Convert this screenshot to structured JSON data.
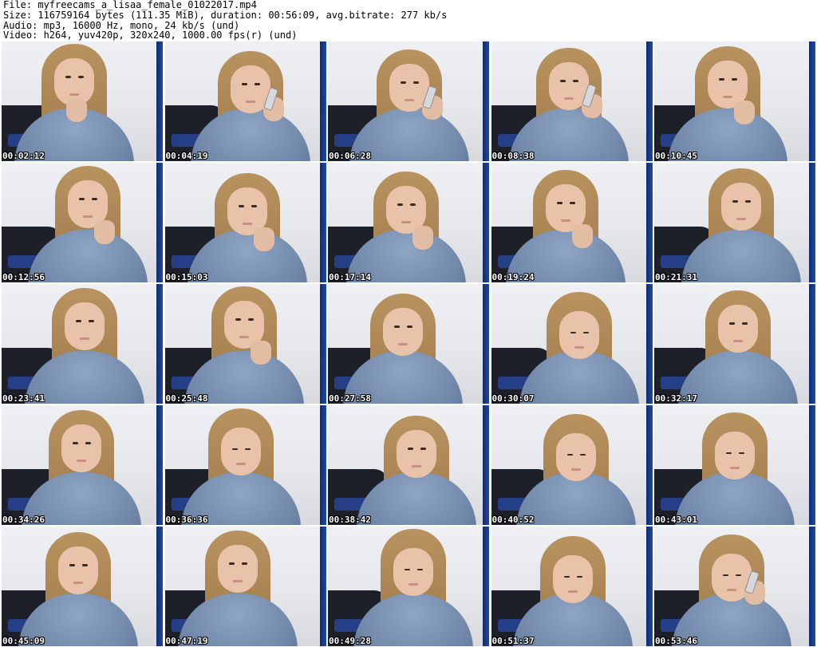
{
  "header": {
    "file_line": "File: myfreecams_a_lisaa_female_01022017.mp4",
    "size_line": "Size: 116759164 bytes (111.35 MiB), duration: 00:56:09, avg.bitrate: 277 kb/s",
    "audio_line": "Audio: mp3, 16000 Hz, mono, 24 kb/s (und)",
    "video_line": "Video: h264, yuv420p, 320x240, 1000.00 fps(r) (und)"
  },
  "thumbnails": [
    {
      "timestamp": "00:02:12",
      "pose": "chin"
    },
    {
      "timestamp": "00:04:19",
      "pose": "phone"
    },
    {
      "timestamp": "00:06:28",
      "pose": "phone"
    },
    {
      "timestamp": "00:08:38",
      "pose": "phone"
    },
    {
      "timestamp": "00:10:45",
      "pose": "hand"
    },
    {
      "timestamp": "00:12:56",
      "pose": "hand"
    },
    {
      "timestamp": "00:15:03",
      "pose": "hand"
    },
    {
      "timestamp": "00:17:14",
      "pose": "hand"
    },
    {
      "timestamp": "00:19:24",
      "pose": "hand"
    },
    {
      "timestamp": "00:21:31",
      "pose": "none"
    },
    {
      "timestamp": "00:23:41",
      "pose": "none"
    },
    {
      "timestamp": "00:25:48",
      "pose": "hand"
    },
    {
      "timestamp": "00:27:58",
      "pose": "none"
    },
    {
      "timestamp": "00:30:07",
      "pose": "down"
    },
    {
      "timestamp": "00:32:17",
      "pose": "none"
    },
    {
      "timestamp": "00:34:26",
      "pose": "none"
    },
    {
      "timestamp": "00:36:36",
      "pose": "down"
    },
    {
      "timestamp": "00:38:42",
      "pose": "none"
    },
    {
      "timestamp": "00:40:52",
      "pose": "down"
    },
    {
      "timestamp": "00:43:01",
      "pose": "down"
    },
    {
      "timestamp": "00:45:09",
      "pose": "none"
    },
    {
      "timestamp": "00:47:19",
      "pose": "none"
    },
    {
      "timestamp": "00:49:28",
      "pose": "down"
    },
    {
      "timestamp": "00:51:37",
      "pose": "down"
    },
    {
      "timestamp": "00:53:46",
      "pose": "phone-down"
    }
  ]
}
